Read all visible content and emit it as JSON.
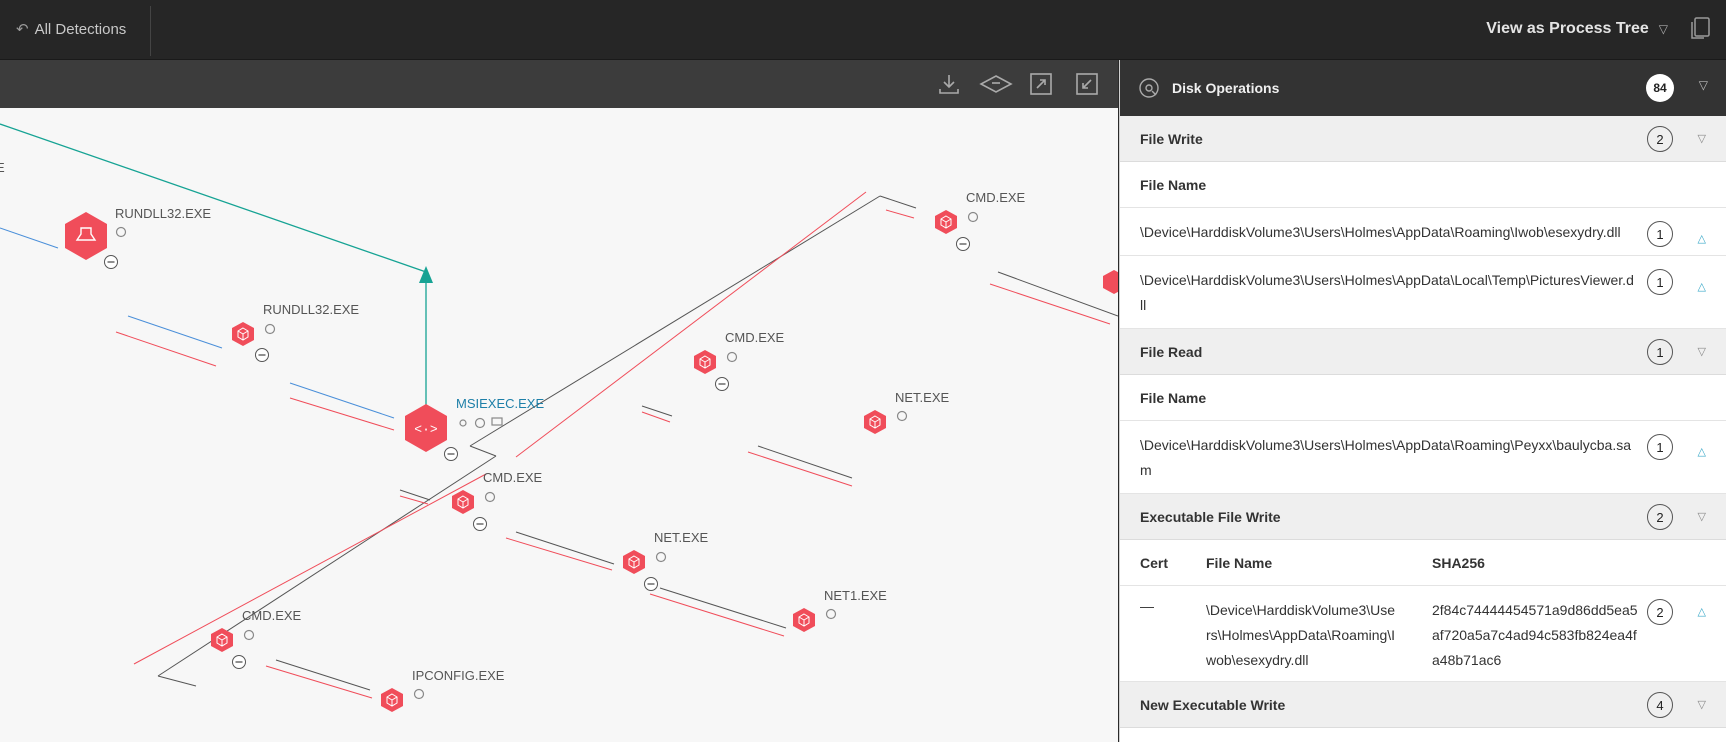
{
  "topbar": {
    "back_label": "All Detections",
    "view_label": "View as Process Tree"
  },
  "graph": {
    "nodes": [
      {
        "label": "RUNDLL32.EXE"
      },
      {
        "label": "RUNDLL32.EXE"
      },
      {
        "label": "MSIEXEC.EXE"
      },
      {
        "label": "CMD.EXE"
      },
      {
        "label": "CMD.EXE"
      },
      {
        "label": "NET.EXE"
      },
      {
        "label": "CMD.EXE"
      },
      {
        "label": "NET.EXE"
      },
      {
        "label": "NET1.EXE"
      },
      {
        "label": "CMD.EXE"
      },
      {
        "label": "IPCONFIG.EXE"
      },
      {
        "label": "E"
      }
    ]
  },
  "panel": {
    "title": "Disk Operations",
    "count": "84",
    "file_write": {
      "label": "File Write",
      "count": "2",
      "col_file_name": "File Name",
      "rows": [
        {
          "path": "\\Device\\HarddiskVolume3\\Users\\Holmes\\AppData\\Roaming\\Iwob\\esexydry.dll",
          "count": "1"
        },
        {
          "path": "\\Device\\HarddiskVolume3\\Users\\Holmes\\AppData\\Local\\Temp\\PicturesViewer.dll",
          "count": "1"
        }
      ]
    },
    "file_read": {
      "label": "File Read",
      "count": "1",
      "col_file_name": "File Name",
      "rows": [
        {
          "path": "\\Device\\HarddiskVolume3\\Users\\Holmes\\AppData\\Roaming\\Peyxx\\baulycba.sam",
          "count": "1"
        }
      ]
    },
    "exe_write": {
      "label": "Executable File Write",
      "count": "2",
      "col_cert": "Cert",
      "col_file_name": "File Name",
      "col_sha": "SHA256",
      "rows": [
        {
          "cert": "—",
          "path": "\\Device\\HarddiskVolume3\\Users\\Holmes\\AppData\\Roaming\\Iwob\\esexydry.dll",
          "sha": "2f84c74444454571a9d86dd5ea5af720a5a7c4ad94c583fb824ea4fa48b71ac6",
          "count": "2"
        }
      ]
    },
    "new_exe_write": {
      "label": "New Executable Write",
      "count": "4"
    }
  },
  "colors": {
    "node_red": "#f04d5a",
    "accent_teal": "#16a394",
    "accent_blue": "#4a8fd9",
    "selected_label": "#1d7fa8"
  }
}
